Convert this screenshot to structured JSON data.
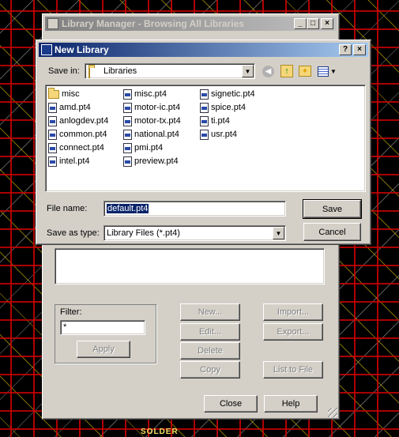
{
  "background": {
    "pcb_text": "SOLDER"
  },
  "library_manager": {
    "title": "Library Manager - Browsing All Libraries",
    "filter": {
      "group_label": "Filter:",
      "value": "*",
      "apply_label": "Apply"
    },
    "buttons": {
      "new": "New...",
      "edit": "Edit...",
      "delete": "Delete",
      "copy": "Copy",
      "import": "Import...",
      "export": "Export...",
      "list_to_file": "List to File",
      "close": "Close",
      "help": "Help"
    }
  },
  "new_library": {
    "title": "New Library",
    "help_glyph": "?",
    "close_glyph": "×",
    "save_in_label": "Save in:",
    "save_in_value": "Libraries",
    "files": [
      {
        "name": "misc",
        "type": "folder"
      },
      {
        "name": "amd.pt4",
        "type": "file"
      },
      {
        "name": "anlogdev.pt4",
        "type": "file"
      },
      {
        "name": "common.pt4",
        "type": "file"
      },
      {
        "name": "connect.pt4",
        "type": "file"
      },
      {
        "name": "intel.pt4",
        "type": "file"
      },
      {
        "name": "misc.pt4",
        "type": "file"
      },
      {
        "name": "motor-ic.pt4",
        "type": "file"
      },
      {
        "name": "motor-tx.pt4",
        "type": "file"
      },
      {
        "name": "national.pt4",
        "type": "file"
      },
      {
        "name": "pmi.pt4",
        "type": "file"
      },
      {
        "name": "preview.pt4",
        "type": "file"
      },
      {
        "name": "signetic.pt4",
        "type": "file"
      },
      {
        "name": "spice.pt4",
        "type": "file"
      },
      {
        "name": "ti.pt4",
        "type": "file"
      },
      {
        "name": "usr.pt4",
        "type": "file"
      }
    ],
    "file_name_label": "File name:",
    "file_name_value": "default.pt4",
    "save_as_type_label": "Save as type:",
    "save_as_type_value": "Library Files (*.pt4)",
    "save_label": "Save",
    "cancel_label": "Cancel"
  },
  "colors": {
    "dialog_face": "#d4d0c8",
    "active_title": "#0a246a",
    "inactive_title": "#808080",
    "selection": "#0a246a"
  }
}
